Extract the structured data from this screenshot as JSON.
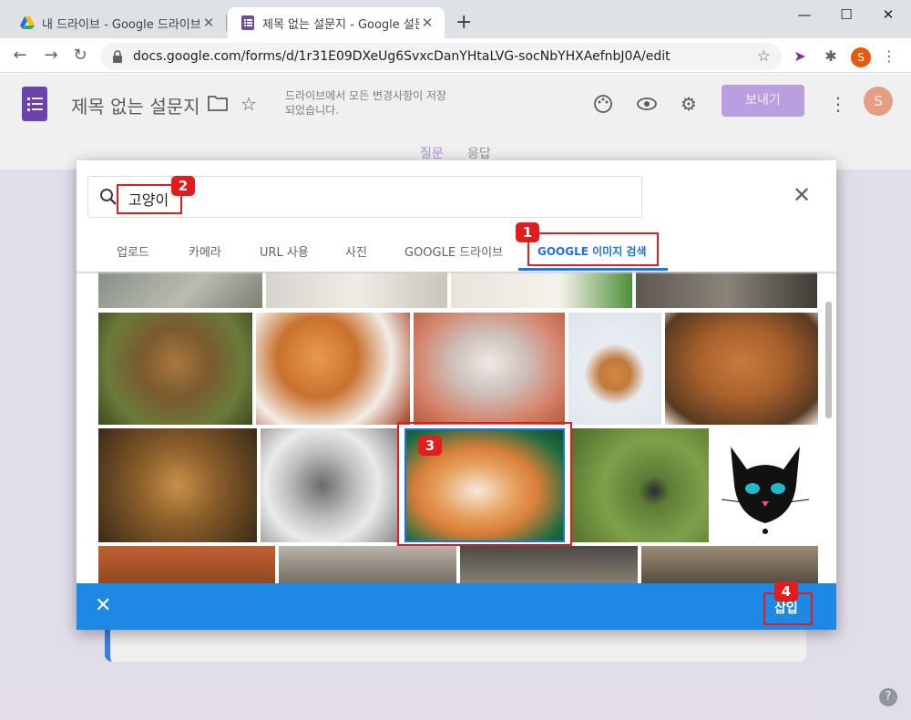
{
  "browser": {
    "tabs": [
      {
        "title": "내 드라이브 - Google 드라이브",
        "icon": "google-drive-icon",
        "active": false
      },
      {
        "title": "제목 없는 설문지 - Google 설문",
        "icon": "google-forms-icon",
        "active": true
      }
    ],
    "url": "docs.google.com/forms/d/1r31E09DXeUg6SvxcDanYHtaLVG-socNbYHXAefnbJ0A/edit",
    "profile_initial": "S"
  },
  "forms": {
    "doc_title": "제목 없는 설문지",
    "save_status": "드라이브에서 모든 변경사항이 저장되었습니다.",
    "send_label": "보내기",
    "avatar_initial": "S",
    "tabs": [
      "질문",
      "응답"
    ],
    "accent_color": "#673ab7"
  },
  "picker": {
    "search_value": "고양이",
    "tabs": [
      "업로드",
      "카메라",
      "URL 사용",
      "사진",
      "GOOGLE 드라이브",
      "GOOGLE 이미지 검색"
    ],
    "active_tab_index": 5,
    "insert_label": "삽입",
    "accent_color": "#1a73e8",
    "bar_color": "#1e88e5"
  },
  "annotations": {
    "badges": [
      "1",
      "2",
      "3",
      "4"
    ],
    "color": "#e11d1d"
  },
  "help_glyph": "?"
}
